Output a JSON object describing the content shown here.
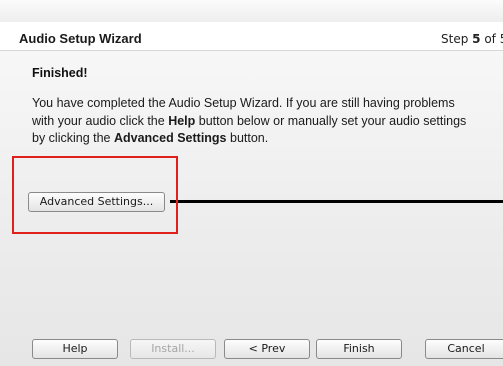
{
  "wizard": {
    "title": "Audio Setup Wizard",
    "step_prefix": "Step ",
    "step_current": "5",
    "step_suffix": " of 5"
  },
  "content": {
    "heading": "Finished!",
    "line1": "You have completed the Audio Setup Wizard. If you are still having problems",
    "line2_a": "with your audio click the ",
    "line2_help": "Help",
    "line2_b": " button below or manually set your audio settings",
    "line3_a": "by clicking the ",
    "line3_adv": "Advanced Settings",
    "line3_b": " button."
  },
  "buttons": {
    "advanced_settings": "Advanced Settings...",
    "help": "Help",
    "install": "Install...",
    "prev": "< Prev",
    "finish": "Finish",
    "cancel": "Cancel"
  },
  "colors": {
    "highlight": "#e0201c"
  }
}
